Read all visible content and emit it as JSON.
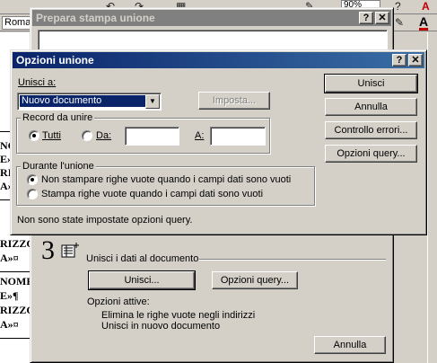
{
  "word": {
    "font_box": "Roman",
    "zoom": "90%",
    "doc_lines": [
      "NOME",
      "E»¶",
      "RIZZO",
      "A»¤",
      "NOME",
      "E»¶",
      "RIZZO",
      "A»¤"
    ],
    "toolbar_font_color_letter": "A",
    "toolbar_font_color_top": "A"
  },
  "main_dialog": {
    "title": "Prepara stampa unione",
    "help_btn": "?",
    "close_btn": "✕",
    "step_number": "3",
    "step_title": "Unisci i dati al documento",
    "merge_button": "Unisci...",
    "query_options_button": "Opzioni query...",
    "active_options_label": "Opzioni attive:",
    "active_options": [
      "Elimina le righe vuote negli indirizzi",
      "Unisci in nuovo documento"
    ],
    "cancel_button": "Annulla"
  },
  "merge_dialog": {
    "title": "Opzioni unione",
    "help_btn": "?",
    "close_btn": "✕",
    "merge_to_label": "Unisci a:",
    "merge_to_value": "Nuovo documento",
    "setup_button": "Imposta...",
    "records_group_label": "Record da unire",
    "radio_all": "Tutti",
    "radio_from": "Da:",
    "to_label": "A:",
    "from_value": "",
    "to_value": "",
    "during_group_label": "Durante l'unione",
    "option_no_blank": "Non stampare righe vuote quando i campi dati sono vuoti",
    "option_print_blank": "Stampa righe vuote quando i campi dati sono vuoti",
    "status_text": "Non sono state impostate opzioni query.",
    "buttons": {
      "merge": "Unisci",
      "cancel": "Annulla",
      "check_errors": "Controllo errori...",
      "query_options": "Opzioni query..."
    }
  }
}
